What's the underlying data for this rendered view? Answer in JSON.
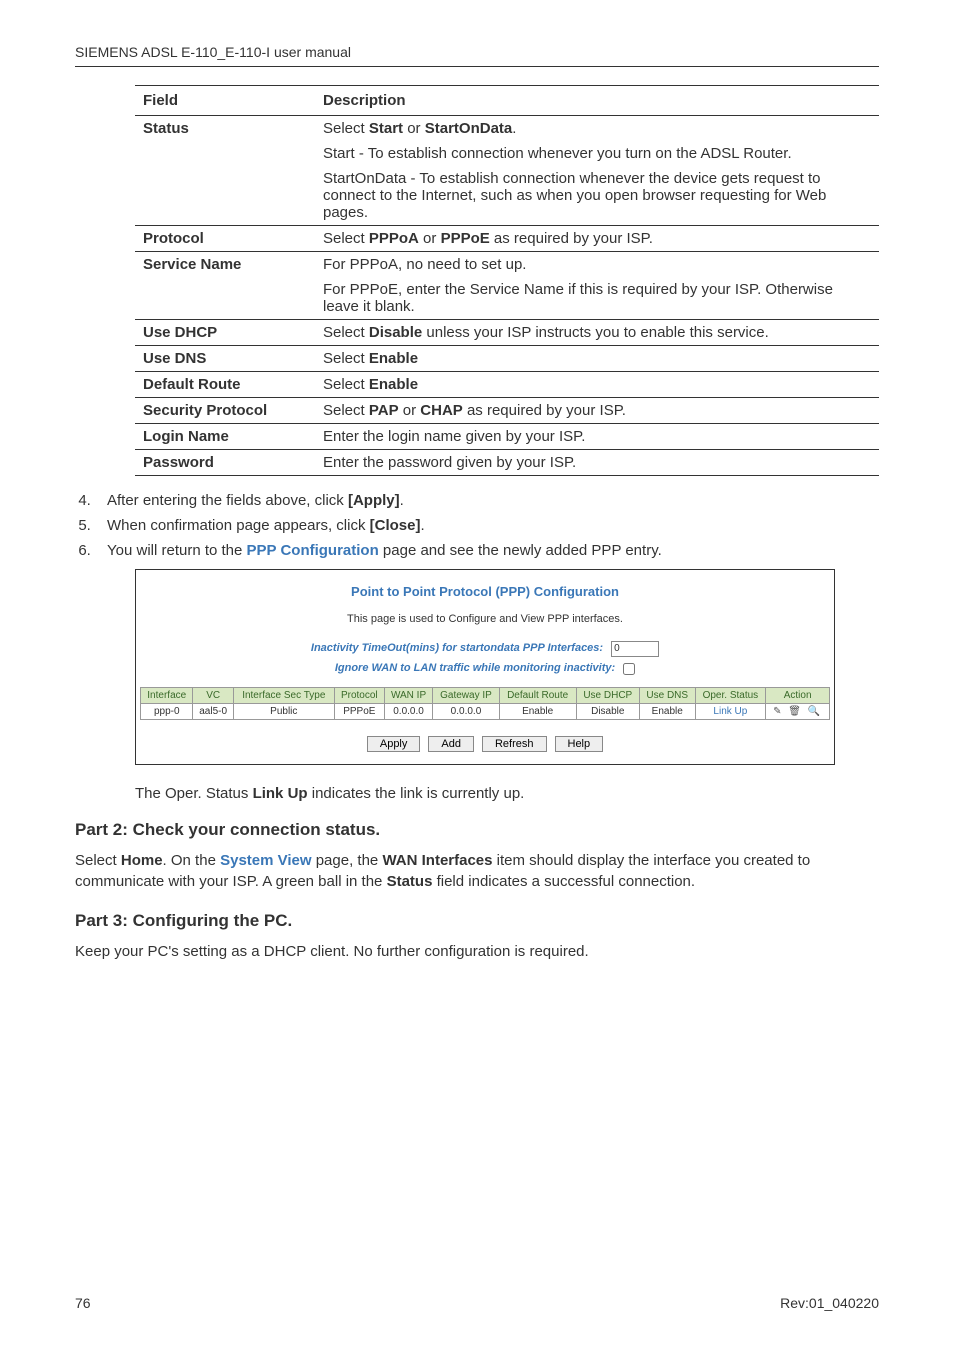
{
  "header": {
    "title": "SIEMENS ADSL E-110_E-110-I user manual"
  },
  "field_table": {
    "cols": [
      "Field",
      "Description"
    ],
    "rows": [
      {
        "field": "Status",
        "desc_parts": [
          {
            "pre": "Select ",
            "b1": "Start",
            "mid": " or ",
            "b2": "StartOnData",
            "post": "."
          },
          {
            "text": "Start - To establish connection whenever you turn on the ADSL Router."
          },
          {
            "text": "StartOnData - To establish connection whenever the device gets request to connect to the Internet, such as when you open browser requesting for Web pages."
          }
        ]
      },
      {
        "field": "Protocol",
        "desc_parts": [
          {
            "pre": "Select ",
            "b1": "PPPoA",
            "mid": " or ",
            "b2": "PPPoE",
            "post": " as required by your ISP."
          }
        ]
      },
      {
        "field": "Service Name",
        "desc_parts": [
          {
            "text": "For PPPoA, no need to set up."
          },
          {
            "text": "For PPPoE, enter the Service Name if this is required by your ISP. Otherwise leave it blank."
          }
        ]
      },
      {
        "field": "Use DHCP",
        "desc_parts": [
          {
            "pre": "Select ",
            "b1": "Disable",
            "mid": "",
            "b2": "",
            "post": " unless your ISP instructs you to enable this service."
          }
        ]
      },
      {
        "field": "Use DNS",
        "desc_parts": [
          {
            "pre": "Select ",
            "b1": "Enable",
            "mid": "",
            "b2": "",
            "post": ""
          }
        ]
      },
      {
        "field": "Default Route",
        "desc_parts": [
          {
            "pre": "Select ",
            "b1": "Enable",
            "mid": "",
            "b2": "",
            "post": ""
          }
        ]
      },
      {
        "field": "Security Protocol",
        "desc_parts": [
          {
            "pre": "Select ",
            "b1": "PAP",
            "mid": " or ",
            "b2": "CHAP",
            "post": " as required by your ISP."
          }
        ]
      },
      {
        "field": "Login Name",
        "desc_parts": [
          {
            "text": "Enter the login name given by your ISP."
          }
        ]
      },
      {
        "field": "Password",
        "desc_parts": [
          {
            "text": "Enter the password given by your ISP."
          }
        ]
      }
    ]
  },
  "steps": {
    "start": 4,
    "items": [
      {
        "pre": "After entering the fields above, click ",
        "b": "[Apply]",
        "post": "."
      },
      {
        "pre": "When confirmation page appears, click ",
        "b": "[Close]",
        "post": "."
      },
      {
        "pre": "You will return to the ",
        "link": "PPP Configuration",
        "post": " page and see the newly added PPP entry."
      }
    ]
  },
  "screenshot": {
    "title": "Point to Point Protocol (PPP) Configuration",
    "subtitle": "This page is used to Configure and View PPP interfaces.",
    "opt1_label": "Inactivity TimeOut(mins) for startondata PPP Interfaces:",
    "opt1_value": "0",
    "opt2_label": "Ignore WAN to LAN traffic while monitoring inactivity:",
    "grid": {
      "headers": [
        "Interface",
        "VC",
        "Interface Sec Type",
        "Protocol",
        "WAN IP",
        "Gateway IP",
        "Default Route",
        "Use DHCP",
        "Use DNS",
        "Oper. Status",
        "Action"
      ],
      "row": {
        "interface": "ppp-0",
        "vc": "aal5-0",
        "sec": "Public",
        "proto": "PPPoE",
        "wanip": "0.0.0.0",
        "gwip": "0.0.0.0",
        "droute": "Enable",
        "dhcp": "Disable",
        "dns": "Enable",
        "oper": "Link Up",
        "action": "✎ 🗑 🔍"
      }
    },
    "buttons": [
      "Apply",
      "Add",
      "Refresh",
      "Help"
    ]
  },
  "after_shot": {
    "pre": "The Oper. Status ",
    "b": "Link Up",
    "post": " indicates the link is currently up."
  },
  "part2": {
    "heading": "Part 2: Check your connection status.",
    "text_pre": "Select ",
    "b1": "Home",
    "mid1": ". On the ",
    "link": "System View",
    "mid2": " page, the ",
    "b2": "WAN Interfaces",
    "mid3": " item should display the interface you created to communicate with your ISP. A green ball in the ",
    "b3": "Status",
    "post": " field indicates a successful connection."
  },
  "part3": {
    "heading": "Part 3: Configuring the PC.",
    "text": "Keep your PC's setting as a DHCP client. No further configuration is required."
  },
  "footer": {
    "left": "76",
    "right": "Rev:01_040220"
  }
}
